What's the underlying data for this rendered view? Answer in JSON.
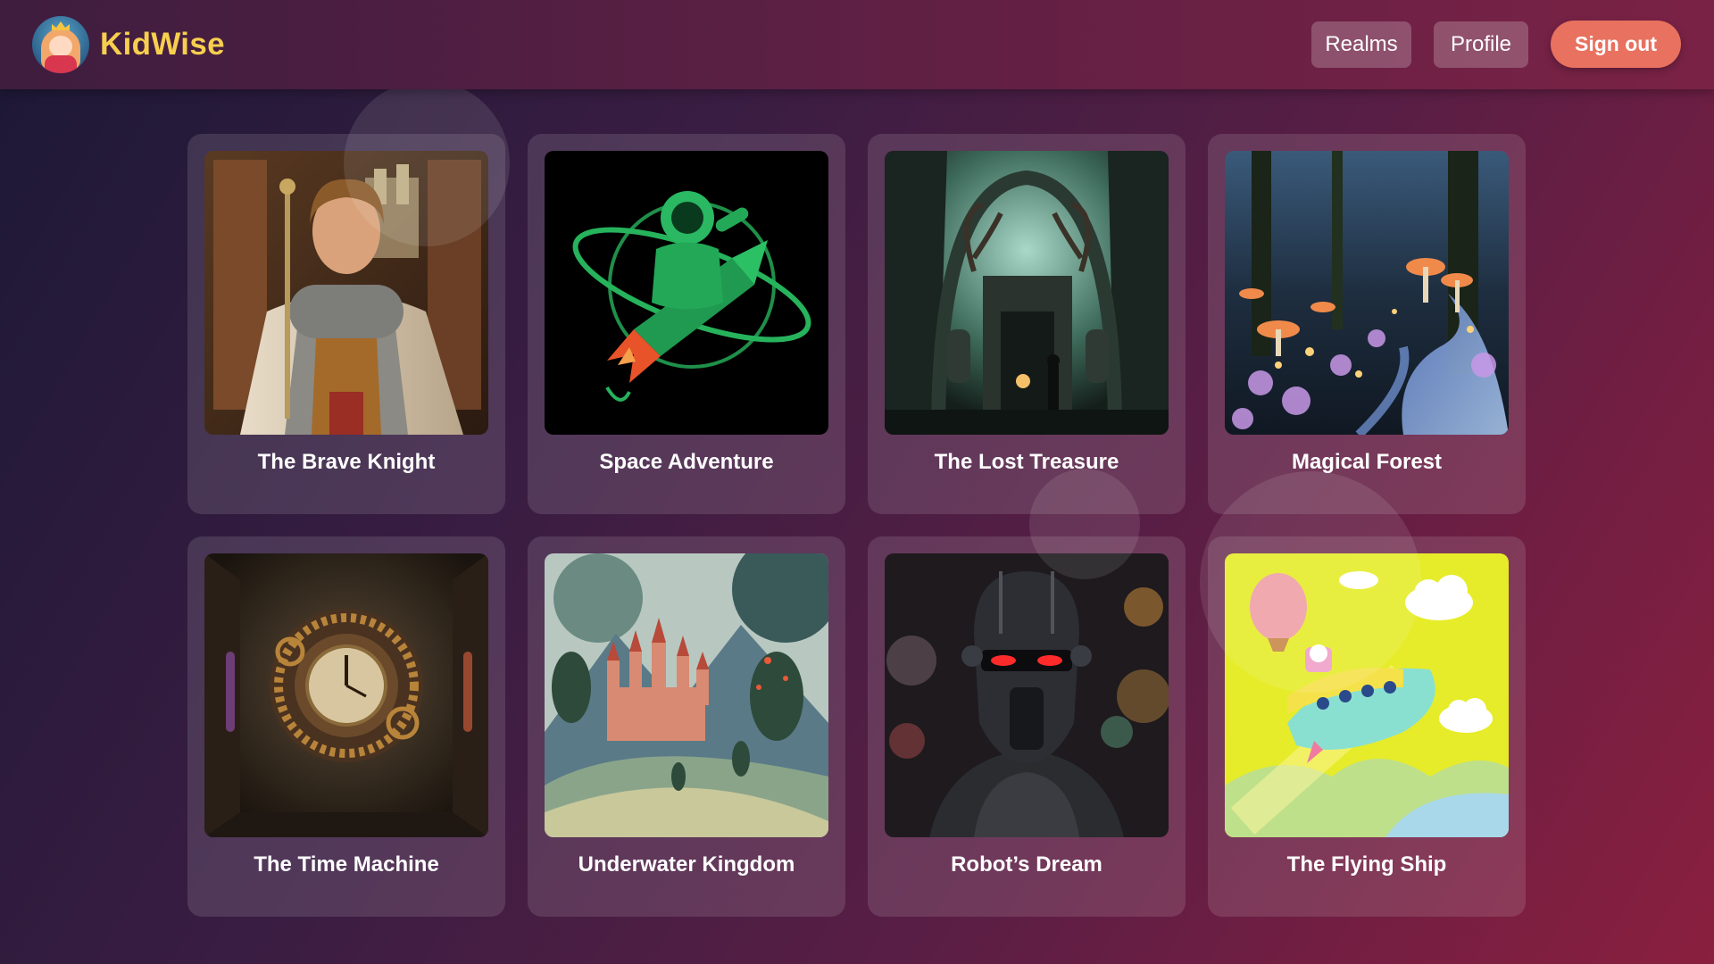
{
  "app": {
    "name": "KidWise",
    "logo_icon": "princess-avatar-icon"
  },
  "nav": {
    "realms_label": "Realms",
    "profile_label": "Profile",
    "signout_label": "Sign out"
  },
  "colors": {
    "brand_text": "#f7cf4e",
    "signout_bg": "#e8715f",
    "card_title": "#ffffff"
  },
  "stories": [
    {
      "title": "The Brave Knight",
      "image": "knight-portrait-image"
    },
    {
      "title": "Space Adventure",
      "image": "astronaut-rocket-image"
    },
    {
      "title": "The Lost Treasure",
      "image": "forest-temple-image"
    },
    {
      "title": "Magical Forest",
      "image": "glowing-mushroom-forest-image"
    },
    {
      "title": "The Time Machine",
      "image": "clock-room-image"
    },
    {
      "title": "Underwater Kingdom",
      "image": "castle-landscape-image"
    },
    {
      "title": "Robot’s Dream",
      "image": "robot-portrait-image"
    },
    {
      "title": "The Flying Ship",
      "image": "flying-ship-cartoon-image"
    }
  ]
}
